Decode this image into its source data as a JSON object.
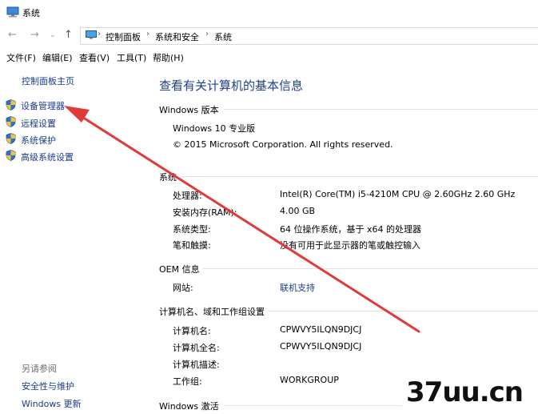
{
  "window": {
    "title": "系统"
  },
  "address": {
    "crumbs": [
      "控制面板",
      "系统和安全",
      "系统"
    ]
  },
  "menu": [
    "文件(F)",
    "编辑(E)",
    "查看(V)",
    "工具(T)",
    "帮助(H)"
  ],
  "sidebar": {
    "home": "控制面板主页",
    "items": [
      {
        "label": "设备管理器",
        "icon": "shield-icon"
      },
      {
        "label": "远程设置",
        "icon": "shield-icon"
      },
      {
        "label": "系统保护",
        "icon": "shield-icon"
      },
      {
        "label": "高级系统设置",
        "icon": "shield-icon"
      }
    ],
    "see_also_heading": "另请参阅",
    "see_also": [
      "安全性与维护",
      "Windows 更新"
    ]
  },
  "main": {
    "title": "查看有关计算机的基本信息",
    "edition_heading": "Windows 版本",
    "edition": "Windows 10 专业版",
    "copyright": "© 2015 Microsoft Corporation. All rights reserved.",
    "system_heading": "系统",
    "system": [
      {
        "key": "处理器:",
        "value": "Intel(R) Core(TM) i5-4210M CPU @ 2.60GHz   2.60 GHz"
      },
      {
        "key": "安装内存(RAM):",
        "value": "4.00 GB"
      },
      {
        "key": "系统类型:",
        "value": "64 位操作系统，基于 x64 的处理器"
      },
      {
        "key": "笔和触摸:",
        "value": "没有可用于此显示器的笔或触控输入"
      }
    ],
    "oem_heading": "OEM 信息",
    "oem": [
      {
        "key": "网站:",
        "value": "联机支持"
      }
    ],
    "computer_heading": "计算机名、域和工作组设置",
    "computer": [
      {
        "key": "计算机名:",
        "value": "CPWVY5ILQN9DJCJ"
      },
      {
        "key": "计算机全名:",
        "value": "CPWVY5ILQN9DJCJ"
      },
      {
        "key": "计算机描述:",
        "value": ""
      },
      {
        "key": "工作组:",
        "value": "WORKGROUP"
      }
    ],
    "activation_heading": "Windows 激活"
  },
  "watermark": "37uu.cn",
  "colors": {
    "link": "#1a3a8a",
    "title": "#1f3f8f",
    "arrow": "#e03a3a"
  }
}
